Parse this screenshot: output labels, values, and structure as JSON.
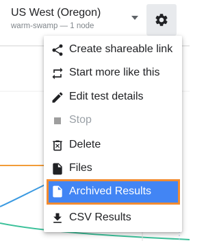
{
  "header": {
    "region": "US West (Oregon)",
    "subtitle": "warm-swamp — 1 node"
  },
  "menu": {
    "items": [
      {
        "label": "Create shareable link",
        "icon": "share-icon",
        "state": "normal"
      },
      {
        "label": "Start more like this",
        "icon": "repeat-icon",
        "state": "normal"
      },
      {
        "label": "Edit test details",
        "icon": "pencil-icon",
        "state": "normal"
      },
      {
        "label": "Stop",
        "icon": "stop-icon",
        "state": "disabled"
      },
      {
        "label": "Delete",
        "icon": "trash-icon",
        "state": "normal"
      },
      {
        "label": "Files",
        "icon": "file-icon",
        "state": "normal"
      },
      {
        "label": "Archived Results",
        "icon": "file-icon",
        "state": "selected"
      },
      {
        "label": "CSV Results",
        "icon": "download-icon",
        "state": "normal"
      }
    ]
  },
  "colors": {
    "selected_bg": "#4285f4",
    "highlight_outline": "#f28b30",
    "line_orange": "#f29c38",
    "line_blue": "#3b9ae1",
    "line_green": "#3cc19a"
  }
}
